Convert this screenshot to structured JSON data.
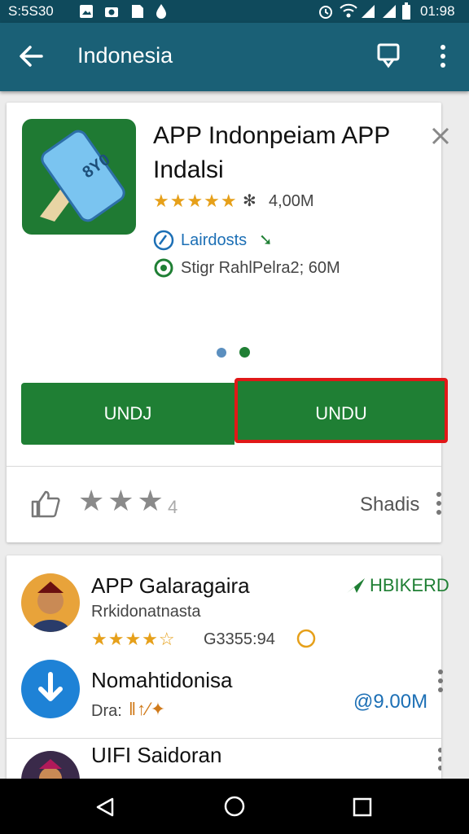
{
  "status_bar": {
    "left_text": "S:5S30",
    "time": "01:98",
    "icons": [
      "image-icon",
      "camera-icon",
      "file-icon",
      "drop-icon",
      "alarm-icon",
      "wifi-icon",
      "signal-icon",
      "signal-icon",
      "battery-icon"
    ]
  },
  "app_bar": {
    "title": "Indonesia",
    "icons": [
      "back-arrow-icon",
      "bookmark-icon",
      "more-vert-icon"
    ]
  },
  "app_card": {
    "name_line1": "APP Indonpeiam APP",
    "name_line2": "Indalsi",
    "rating_stars": 5,
    "rating_text": "4,00M",
    "developer": "Lairdosts",
    "download_info": "Stigr RahlPelra2; 60M",
    "buttons": [
      "UNDJ",
      "UNDU"
    ],
    "feedback_count": "4",
    "share_label": "Shadis",
    "colors": {
      "accent_green": "#1f7f34",
      "highlight_red": "#e01818",
      "link_blue": "#1c6fb5"
    }
  },
  "list": {
    "items": [
      {
        "title": "APP Galaragaira",
        "subtitle": "Rrkidonatnasta",
        "rating_stars": 4,
        "meta": "G3355:94",
        "badge": "HBIKERD"
      },
      {
        "title": "Nomahtidonisa",
        "subtitle": "Dra:",
        "size": "@9.00M"
      },
      {
        "title": "UIFI Saidoran"
      }
    ]
  }
}
